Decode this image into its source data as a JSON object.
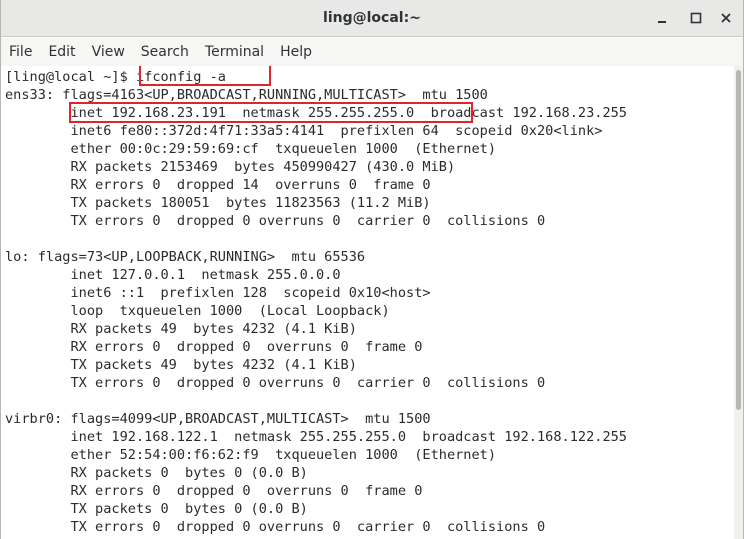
{
  "window": {
    "title": "ling@local:~"
  },
  "menu": [
    "File",
    "Edit",
    "View",
    "Search",
    "Terminal",
    "Help"
  ],
  "terminal": {
    "prompt": "[ling@local ~]$ ",
    "command": "ifconfig -a",
    "lines": [
      "ens33: flags=4163<UP,BROADCAST,RUNNING,MULTICAST>  mtu 1500",
      "        inet 192.168.23.191  netmask 255.255.255.0  broadcast 192.168.23.255",
      "        inet6 fe80::372d:4f71:33a5:4141  prefixlen 64  scopeid 0x20<link>",
      "        ether 00:0c:29:59:69:cf  txqueuelen 1000  (Ethernet)",
      "        RX packets 2153469  bytes 450990427 (430.0 MiB)",
      "        RX errors 0  dropped 14  overruns 0  frame 0",
      "        TX packets 180051  bytes 11823563 (11.2 MiB)",
      "        TX errors 0  dropped 0 overruns 0  carrier 0  collisions 0",
      "",
      "lo: flags=73<UP,LOOPBACK,RUNNING>  mtu 65536",
      "        inet 127.0.0.1  netmask 255.0.0.0",
      "        inet6 ::1  prefixlen 128  scopeid 0x10<host>",
      "        loop  txqueuelen 1000  (Local Loopback)",
      "        RX packets 49  bytes 4232 (4.1 KiB)",
      "        RX errors 0  dropped 0  overruns 0  frame 0",
      "        TX packets 49  bytes 4232 (4.1 KiB)",
      "        TX errors 0  dropped 0 overruns 0  carrier 0  collisions 0",
      "",
      "virbr0: flags=4099<UP,BROADCAST,MULTICAST>  mtu 1500",
      "        inet 192.168.122.1  netmask 255.255.255.0  broadcast 192.168.122.255",
      "        ether 52:54:00:f6:62:f9  txqueuelen 1000  (Ethernet)",
      "        RX packets 0  bytes 0 (0.0 B)",
      "        RX errors 0  dropped 0  overruns 0  frame 0",
      "        TX packets 0  bytes 0 (0.0 B)",
      "        TX errors 0  dropped 0 overruns 0  carrier 0  collisions 0"
    ]
  },
  "colors": {
    "highlight": "#e0242b",
    "text": "#2b2b2b"
  },
  "icons": {
    "minimize": "minimize-icon",
    "maximize": "maximize-icon",
    "close": "close-icon"
  }
}
